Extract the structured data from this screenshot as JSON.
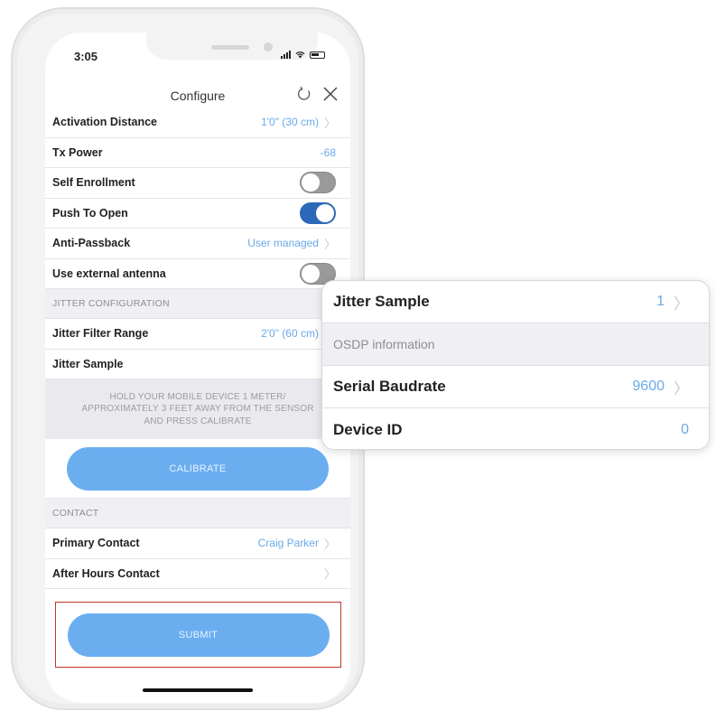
{
  "status_bar": {
    "time": "3:05"
  },
  "nav": {
    "title": "Configure",
    "refresh_icon": "refresh-icon",
    "close_icon": "close-icon"
  },
  "settings": [
    {
      "label": "Activation Distance",
      "value": "1'0\" (30 cm)",
      "chevron": true
    },
    {
      "label": "Tx Power",
      "value": "-68",
      "chevron": false
    },
    {
      "label": "Self Enrollment",
      "toggle": false
    },
    {
      "label": "Push To Open",
      "toggle": true
    },
    {
      "label": "Anti-Passback",
      "value": "User managed",
      "chevron": true
    },
    {
      "label": "Use external antenna",
      "toggle": false
    }
  ],
  "jitter": {
    "header": "JITTER CONFIGURATION",
    "filter_range_label": "Jitter Filter Range",
    "filter_range_value": "2'0\" (60 cm)",
    "sample_label": "Jitter Sample",
    "sample_value": "1"
  },
  "instruction": "HOLD YOUR MOBILE DEVICE 1 METER/ APPROXIMATELY 3 FEET AWAY FROM THE SENSOR AND PRESS CALIBRATE",
  "calibrate_label": "CALIBRATE",
  "contact": {
    "header": "CONTACT",
    "primary_label": "Primary Contact",
    "primary_value": "Craig Parker",
    "after_hours_label": "After Hours Contact",
    "after_hours_value": ""
  },
  "submit_label": "SUBMIT",
  "callout": {
    "jitter_sample_label": "Jitter Sample",
    "jitter_sample_value": "1",
    "osdp_header": "OSDP information",
    "serial_baudrate_label": "Serial Baudrate",
    "serial_baudrate_value": "9600",
    "device_id_label": "Device ID",
    "device_id_value": "0"
  },
  "colors": {
    "accent": "#6aa9e8",
    "button": "#6aaef0",
    "toggle_on": "#2c68b8",
    "highlight_border": "#c0392b"
  }
}
